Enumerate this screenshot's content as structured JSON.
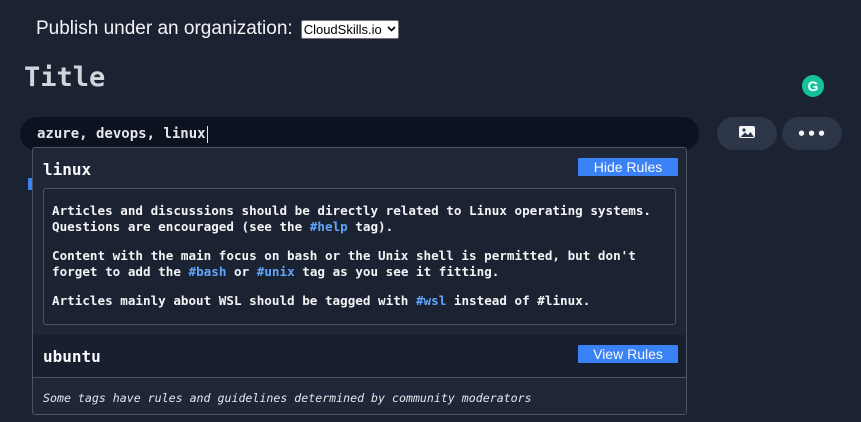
{
  "publish": {
    "label": "Publish under an organization:",
    "selected_org": "CloudSkills.io"
  },
  "title_label": "Title",
  "tags_input": {
    "value": "azure, devops, linux"
  },
  "toolbar": {
    "image_icon": "image-icon",
    "more_icon": "more-options-icon",
    "more_glyph": "•••"
  },
  "grammarly": {
    "letter": "G",
    "color": "#15c39a"
  },
  "tag_suggestions": [
    {
      "name": "linux",
      "button_label": "Hide Rules",
      "rules": {
        "p1_a": "Articles and discussions should be directly related to Linux operating systems. Questions are encouraged (see the ",
        "p1_link": "#help",
        "p1_b": " tag).",
        "p2_a": "Content with the main focus on bash or the Unix shell is permitted, but don't forget to add the ",
        "p2_link1": "#bash",
        "p2_mid": " or ",
        "p2_link2": "#unix",
        "p2_b": " tag as you see it fitting.",
        "p3_a": "Articles mainly about WSL should be tagged with ",
        "p3_link": "#wsl",
        "p3_b": " instead of #linux."
      }
    },
    {
      "name": "ubuntu",
      "button_label": "View Rules"
    }
  ],
  "footer_note": "Some tags have rules and guidelines determined by community moderators",
  "colors": {
    "background": "#1b2231",
    "accent": "#3b82f6",
    "link": "#60a5fa"
  }
}
